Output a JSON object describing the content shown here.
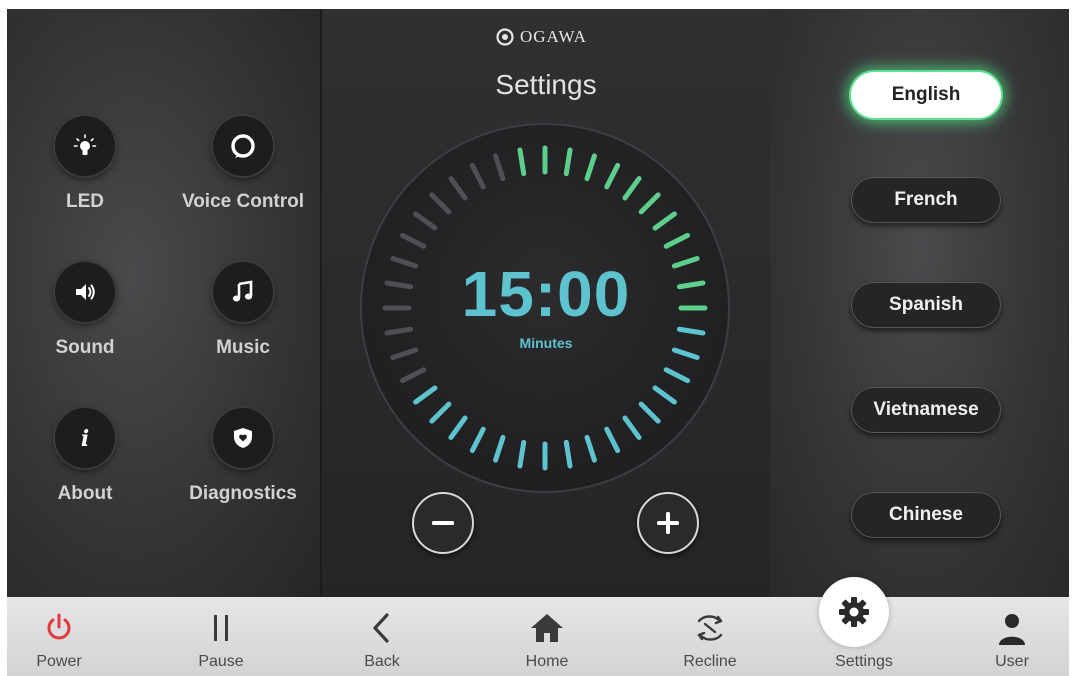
{
  "brand": {
    "name": "OGAWA"
  },
  "settings": {
    "title": "Settings"
  },
  "left_panel": {
    "tiles": [
      {
        "label": "LED",
        "icon": "lightbulb-icon"
      },
      {
        "label": "Voice Control",
        "icon": "alexa-ring-icon"
      },
      {
        "label": "Sound",
        "icon": "speaker-icon"
      },
      {
        "label": "Music",
        "icon": "music-note-icon"
      },
      {
        "label": "About",
        "icon": "info-icon"
      },
      {
        "label": "Diagnostics",
        "icon": "shield-heart-icon"
      }
    ]
  },
  "timer": {
    "value": "15:00",
    "unit": "Minutes",
    "active_color": "#5cc3cf",
    "accent_color": "#5ccf8c",
    "decrease_icon": "minus-icon",
    "increase_icon": "plus-icon"
  },
  "languages": {
    "options": [
      "English",
      "French",
      "Spanish",
      "Vietnamese",
      "Chinese"
    ],
    "selected": "English",
    "glow_color": "#5cdc8c"
  },
  "navbar": {
    "items": [
      {
        "label": "Power",
        "icon": "power-icon",
        "color": "#e23a3a"
      },
      {
        "label": "Pause",
        "icon": "pause-icon"
      },
      {
        "label": "Back",
        "icon": "chevron-left-icon"
      },
      {
        "label": "Home",
        "icon": "home-icon"
      },
      {
        "label": "Recline",
        "icon": "recline-icon"
      },
      {
        "label": "Settings",
        "icon": "gear-icon",
        "active": true
      },
      {
        "label": "User",
        "icon": "user-icon"
      }
    ]
  }
}
